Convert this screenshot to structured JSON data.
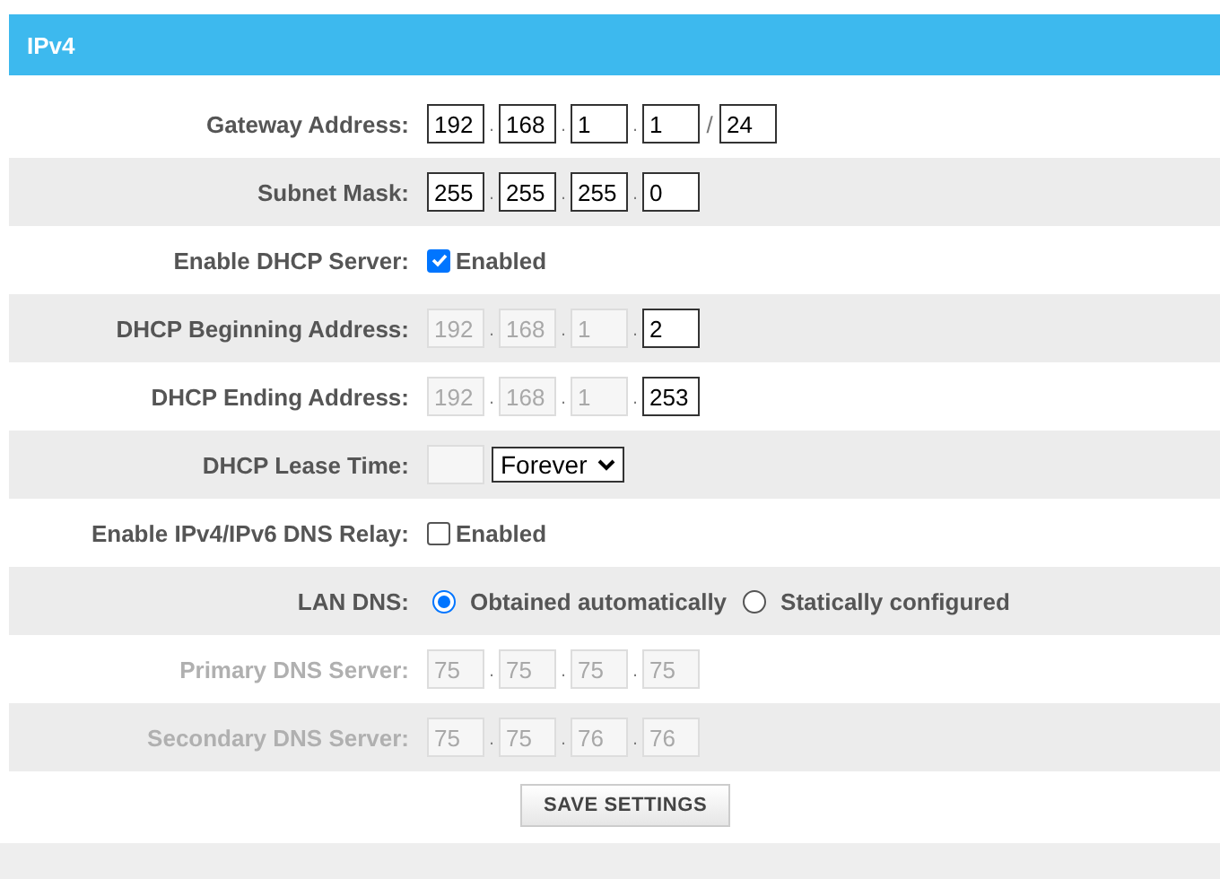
{
  "header": {
    "title": "IPv4"
  },
  "rows": [
    {
      "kind": "ip",
      "label": "Gateway Address:",
      "disabled": false,
      "dot": ".",
      "octets": [
        {
          "value": "192",
          "disabled": false
        },
        {
          "value": "168",
          "disabled": false
        },
        {
          "value": "1",
          "disabled": false
        },
        {
          "value": "1",
          "disabled": false
        }
      ],
      "separator": "/",
      "prefix": "24"
    },
    {
      "kind": "ip",
      "label": "Subnet Mask:",
      "disabled": false,
      "dot": ".",
      "octets": [
        {
          "value": "255",
          "disabled": false
        },
        {
          "value": "255",
          "disabled": false
        },
        {
          "value": "255",
          "disabled": false
        },
        {
          "value": "0",
          "disabled": false
        }
      ]
    },
    {
      "kind": "checkbox",
      "label": "Enable DHCP Server:",
      "disabled": false,
      "checked": true,
      "text": "Enabled"
    },
    {
      "kind": "ip",
      "label": "DHCP Beginning Address:",
      "disabled": false,
      "dot": ".",
      "octets": [
        {
          "value": "192",
          "disabled": true
        },
        {
          "value": "168",
          "disabled": true
        },
        {
          "value": "1",
          "disabled": true
        },
        {
          "value": "2",
          "disabled": false
        }
      ]
    },
    {
      "kind": "ip",
      "label": "DHCP Ending Address:",
      "disabled": false,
      "dot": ".",
      "octets": [
        {
          "value": "192",
          "disabled": true
        },
        {
          "value": "168",
          "disabled": true
        },
        {
          "value": "1",
          "disabled": true
        },
        {
          "value": "253",
          "disabled": false
        }
      ]
    },
    {
      "kind": "lease",
      "label": "DHCP Lease Time:",
      "disabled": false,
      "input_disabled": true,
      "select": "Forever"
    },
    {
      "kind": "checkbox",
      "label": "Enable IPv4/IPv6 DNS Relay:",
      "disabled": false,
      "checked": false,
      "text": "Enabled"
    },
    {
      "kind": "radio",
      "label": "LAN DNS:",
      "disabled": false,
      "options": [
        {
          "label": "Obtained automatically",
          "selected": true
        },
        {
          "label": "Statically configured",
          "selected": false
        }
      ]
    },
    {
      "kind": "ip",
      "label": "Primary DNS Server:",
      "disabled": true,
      "dot": ".",
      "octets": [
        {
          "value": "75",
          "disabled": true
        },
        {
          "value": "75",
          "disabled": true
        },
        {
          "value": "75",
          "disabled": true
        },
        {
          "value": "75",
          "disabled": true
        }
      ]
    },
    {
      "kind": "ip",
      "label": "Secondary DNS Server:",
      "disabled": true,
      "dot": ".",
      "octets": [
        {
          "value": "75",
          "disabled": true
        },
        {
          "value": "75",
          "disabled": true
        },
        {
          "value": "76",
          "disabled": true
        },
        {
          "value": "76",
          "disabled": true
        }
      ]
    }
  ],
  "save_button": "SAVE SETTINGS"
}
